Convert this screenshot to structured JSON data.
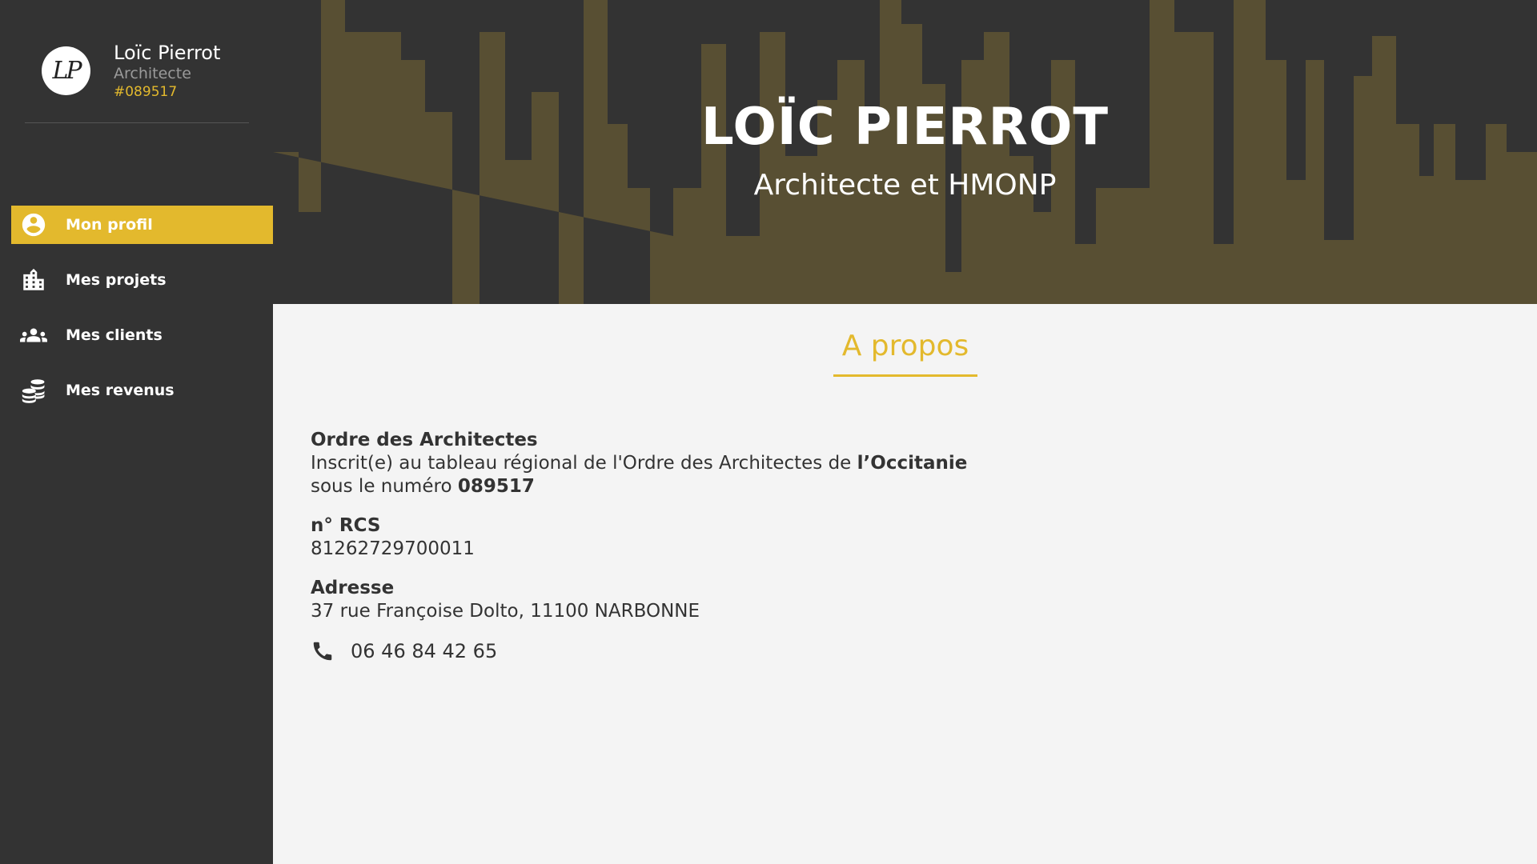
{
  "sidebar": {
    "user": {
      "monogram": "LP",
      "name": "Loïc Pierrot",
      "role": "Architecte",
      "number": "#089517"
    },
    "items": [
      {
        "label": "Mon profil",
        "icon": "account-circle-icon",
        "active": true
      },
      {
        "label": "Mes projets",
        "icon": "building-icon",
        "active": false
      },
      {
        "label": "Mes clients",
        "icon": "people-icon",
        "active": false
      },
      {
        "label": "Mes revenus",
        "icon": "coins-icon",
        "active": false
      }
    ]
  },
  "banner": {
    "title": "LOÏC PIERROT",
    "subtitle": "Architecte et HMONP"
  },
  "about": {
    "title": "A propos",
    "ordre": {
      "label": "Ordre des Architectes",
      "line1_prefix": "Inscrit(e) au tableau régional de l'Ordre des Architectes de ",
      "region": "l’Occitanie",
      "line2_prefix": "sous le numéro ",
      "number": "089517"
    },
    "rcs": {
      "label": "n° RCS",
      "value": "81262729700011"
    },
    "address": {
      "label": "Adresse",
      "value": "37 rue Françoise Dolto, 11100 NARBONNE"
    },
    "phone": {
      "icon": "phone-icon",
      "value": "06 46 84 42 65"
    }
  },
  "colors": {
    "sidebar_bg": "#333333",
    "accent": "#e3b92d",
    "banner_shape": "#584f33",
    "content_bg": "#f4f4f4",
    "text": "#333333"
  }
}
